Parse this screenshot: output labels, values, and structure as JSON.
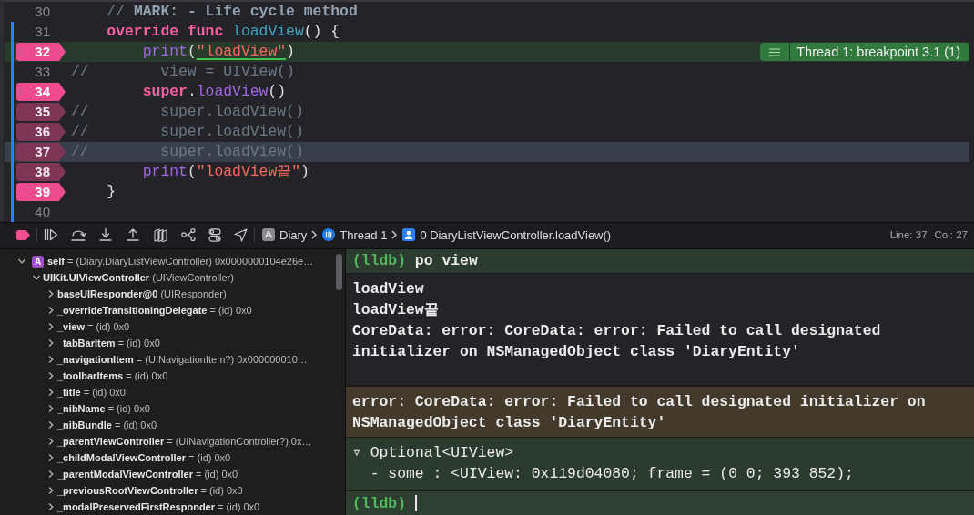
{
  "editor": {
    "lines": [
      {
        "number": "30",
        "breakpoint": false,
        "paused": false,
        "current": false,
        "changed": false,
        "tokens": [
          {
            "kind": "comment",
            "text": "    // "
          },
          {
            "kind": "mark",
            "text": "MARK: - Life cycle method"
          }
        ]
      },
      {
        "number": "31",
        "breakpoint": false,
        "paused": false,
        "current": false,
        "changed": true,
        "tokens": [
          {
            "kind": "keyword",
            "text": "    override func "
          },
          {
            "kind": "decl",
            "text": "loadView"
          },
          {
            "kind": "plain",
            "text": "() {"
          }
        ]
      },
      {
        "number": "32",
        "breakpoint": true,
        "enabled": true,
        "paused": true,
        "current": false,
        "changed": true,
        "tokens": [
          {
            "kind": "call",
            "text": "        print"
          },
          {
            "kind": "plain",
            "text": "("
          },
          {
            "kind": "string",
            "text": "\"loadView\"",
            "underlined": true
          },
          {
            "kind": "plain",
            "text": ")"
          }
        ],
        "annotation": {
          "text": "Thread 1: breakpoint 3.1 (1)"
        }
      },
      {
        "number": "33",
        "breakpoint": false,
        "paused": false,
        "current": false,
        "changed": true,
        "tokens": [
          {
            "kind": "comment",
            "text": "//        view = UIView()"
          }
        ]
      },
      {
        "number": "34",
        "breakpoint": true,
        "enabled": true,
        "paused": false,
        "current": false,
        "changed": true,
        "tokens": [
          {
            "kind": "keyword",
            "text": "        super"
          },
          {
            "kind": "plain",
            "text": "."
          },
          {
            "kind": "call",
            "text": "loadView"
          },
          {
            "kind": "plain",
            "text": "()"
          }
        ]
      },
      {
        "number": "35",
        "breakpoint": true,
        "enabled": false,
        "paused": false,
        "current": false,
        "changed": true,
        "tokens": [
          {
            "kind": "comment",
            "text": "//        super.loadView()"
          }
        ]
      },
      {
        "number": "36",
        "breakpoint": true,
        "enabled": false,
        "paused": false,
        "current": false,
        "changed": true,
        "tokens": [
          {
            "kind": "comment",
            "text": "//        super.loadView()"
          }
        ]
      },
      {
        "number": "37",
        "breakpoint": true,
        "enabled": false,
        "paused": false,
        "current": true,
        "changed": true,
        "tokens": [
          {
            "kind": "comment",
            "text": "//        super.loadView()"
          }
        ]
      },
      {
        "number": "38",
        "breakpoint": true,
        "enabled": false,
        "paused": false,
        "current": false,
        "changed": true,
        "tokens": [
          {
            "kind": "call",
            "text": "        print"
          },
          {
            "kind": "plain",
            "text": "("
          },
          {
            "kind": "string",
            "text": "\"loadView끝\""
          },
          {
            "kind": "plain",
            "text": ")"
          }
        ]
      },
      {
        "number": "39",
        "breakpoint": true,
        "enabled": true,
        "paused": false,
        "current": false,
        "changed": true,
        "tokens": [
          {
            "kind": "plain",
            "text": "    }"
          }
        ]
      },
      {
        "number": "40",
        "breakpoint": false,
        "paused": false,
        "current": false,
        "changed": true
      }
    ]
  },
  "debug_bar": {
    "breakpoints_active": true,
    "breadcrumbs": [
      {
        "kind": "app",
        "label": "Diary"
      },
      {
        "kind": "thread",
        "label": "Thread 1"
      },
      {
        "kind": "frame",
        "label": "0 DiaryListViewController.loadView()"
      }
    ],
    "line": "Line: 37",
    "column": "Col: 27"
  },
  "variables": {
    "items": [
      {
        "badge": "A",
        "name": "self",
        "detail": "= (Diary.DiaryListViewController) 0x0000000104e26e…",
        "expanded": true,
        "children": [
          {
            "name": "UIKit.UIViewController",
            "detail": "(UIViewController)",
            "expanded": true,
            "children": [
              {
                "name": "baseUIResponder@0",
                "detail": "(UIResponder)",
                "expanded": false
              },
              {
                "name": "_overrideTransitioningDelegate",
                "detail": "= (id) 0x0",
                "expanded": false
              },
              {
                "name": "_view",
                "detail": "= (id) 0x0",
                "expanded": false
              },
              {
                "name": "_tabBarItem",
                "detail": "= (id) 0x0",
                "expanded": false
              },
              {
                "name": "_navigationItem",
                "detail": "= (UINavigationItem?) 0x000000010…",
                "expanded": false
              },
              {
                "name": "_toolbarItems",
                "detail": "= (id) 0x0",
                "expanded": false
              },
              {
                "name": "_title",
                "detail": "= (id) 0x0",
                "expanded": false
              },
              {
                "name": "_nibName",
                "detail": "= (id) 0x0",
                "expanded": false
              },
              {
                "name": "_nibBundle",
                "detail": "= (id) 0x0",
                "expanded": false
              },
              {
                "name": "_parentViewController",
                "detail": "= (UINavigationController?) 0x…",
                "expanded": false
              },
              {
                "name": "_childModalViewController",
                "detail": "= (id) 0x0",
                "expanded": false
              },
              {
                "name": "_parentModalViewController",
                "detail": "= (id) 0x0",
                "expanded": false
              },
              {
                "name": "_previousRootViewController",
                "detail": "= (id) 0x0",
                "expanded": false
              },
              {
                "name": "_modalPreservedFirstResponder",
                "detail": "= (id) 0x0",
                "expanded": false
              }
            ]
          }
        ]
      }
    ]
  },
  "console": {
    "blocks": [
      {
        "kind": "command",
        "prompt": "(lldb)",
        "text": "po view"
      },
      {
        "kind": "output",
        "lines": [
          "loadView",
          "loadView끝",
          "CoreData: error: CoreData: error: Failed to call designated initializer on NSManagedObject class 'DiaryEntity'"
        ]
      },
      {
        "kind": "error",
        "lines": [
          "error: CoreData: error: Failed to call designated initializer on NSManagedObject class 'DiaryEntity'"
        ]
      },
      {
        "kind": "result",
        "lines": [
          "▿ Optional<UIView>",
          "  - some : <UIView: 0x119d04080; frame = (0 0; 393 852);"
        ]
      }
    ],
    "input": {
      "prompt": "(lldb)"
    }
  }
}
